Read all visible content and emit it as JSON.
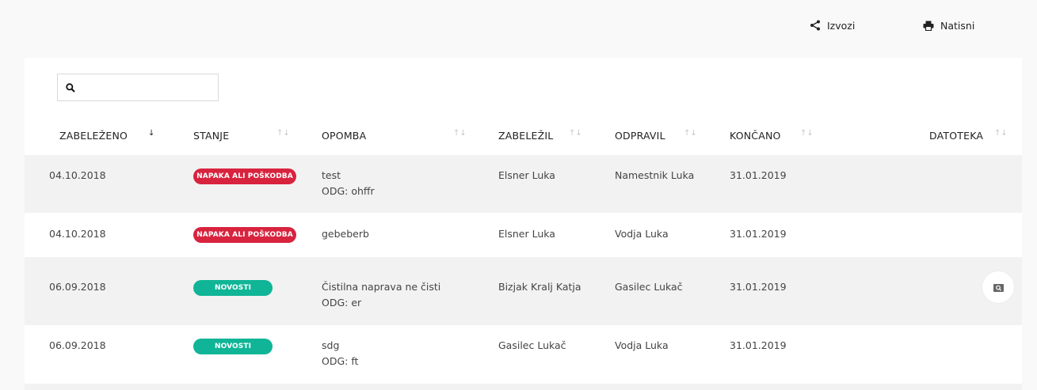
{
  "toolbar": {
    "export_label": "Izvozi",
    "print_label": "Natisni"
  },
  "search": {
    "value": "",
    "placeholder": ""
  },
  "columns": [
    {
      "label": "ZABELEŽENO",
      "sorted": "desc"
    },
    {
      "label": "STANJE"
    },
    {
      "label": "OPOMBA"
    },
    {
      "label": "ZABELEŽIL"
    },
    {
      "label": "ODPRAVIL"
    },
    {
      "label": "KONČANO"
    },
    {
      "label": "DATOTEKA"
    }
  ],
  "rows": [
    {
      "date": "04.10.2018",
      "status": "NAPAKA ALI POŠKODBA",
      "status_color": "#d8233e",
      "note": "test",
      "note_reply": "ODG: ohffr",
      "recorded_by": "Elsner Luka",
      "resolved_by": "Namestnik Luka",
      "finished": "31.01.2019",
      "has_file": false
    },
    {
      "date": "04.10.2018",
      "status": "NAPAKA ALI POŠKODBA",
      "status_color": "#d8233e",
      "note": "gebeberb",
      "note_reply": "",
      "recorded_by": "Elsner Luka",
      "resolved_by": "Vodja Luka",
      "finished": "31.01.2019",
      "has_file": false
    },
    {
      "date": "06.09.2018",
      "status": "NOVOSTI",
      "status_color": "#0fb596",
      "note": "Čistilna naprava ne čisti",
      "note_reply": "ODG: er",
      "recorded_by": "Bizjak Kralj Katja",
      "resolved_by": "Gasilec Lukač",
      "finished": "31.01.2019",
      "has_file": true,
      "file_icon": "image-preview-icon"
    },
    {
      "date": "06.09.2018",
      "status": "NOVOSTI",
      "status_color": "#0fb596",
      "note": "sdg",
      "note_reply": "ODG: ft",
      "recorded_by": "Gasilec Lukač",
      "resolved_by": "Vodja Luka",
      "finished": "31.01.2019",
      "has_file": false
    }
  ]
}
